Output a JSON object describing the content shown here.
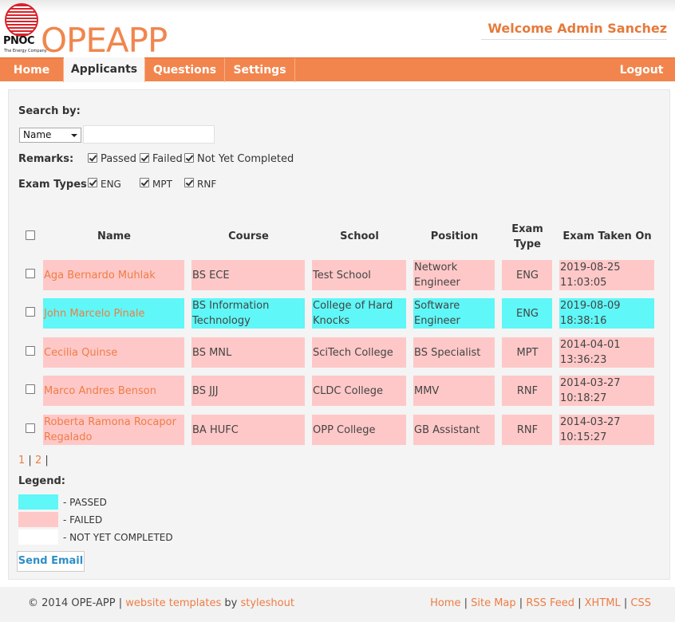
{
  "header": {
    "logo_text": "PNOC",
    "logo_tagline": "The Energy Company",
    "app_title": "OPEAPP",
    "welcome": "Welcome Admin Sanchez"
  },
  "nav": {
    "items": [
      "Home",
      "Applicants",
      "Questions",
      "Settings"
    ],
    "active": "Applicants",
    "logout": "Logout"
  },
  "filters": {
    "search_label": "Search by:",
    "search_field_selected": "Name",
    "search_value": "",
    "remarks_label": "Remarks:",
    "remarks": [
      {
        "label": "Passed",
        "checked": true
      },
      {
        "label": "Failed",
        "checked": true
      },
      {
        "label": "Not Yet Completed",
        "checked": true
      }
    ],
    "exam_types_label": "Exam Types:",
    "exam_types": [
      {
        "label": "ENG",
        "checked": true
      },
      {
        "label": "MPT",
        "checked": true
      },
      {
        "label": "RNF",
        "checked": true
      }
    ]
  },
  "table": {
    "columns": [
      "Name",
      "Course",
      "School",
      "Position",
      "Exam Type",
      "Exam Taken On"
    ],
    "rows": [
      {
        "name": "Aga Bernardo Muhlak",
        "course": "BS ECE",
        "school": "Test School",
        "position": "Network Engineer",
        "exam_type": "ENG",
        "taken_on": "2019-08-25 11:03:05",
        "status": "failed"
      },
      {
        "name": "John Marcelo Pinale",
        "course": "BS Information Technology",
        "school": "College of Hard Knocks",
        "position": "Software Engineer",
        "exam_type": "ENG",
        "taken_on": "2019-08-09 18:38:16",
        "status": "passed"
      },
      {
        "name": "Cecilia Quinse",
        "course": "BS MNL",
        "school": "SciTech College",
        "position": "BS Specialist",
        "exam_type": "MPT",
        "taken_on": "2014-04-01 13:36:23",
        "status": "failed"
      },
      {
        "name": "Marco Andres Benson",
        "course": "BS JJJ",
        "school": "CLDC College",
        "position": "MMV",
        "exam_type": "RNF",
        "taken_on": "2014-03-27 10:18:27",
        "status": "failed"
      },
      {
        "name": "Roberta Ramona Rocapor Regalado",
        "course": "BA HUFC",
        "school": "OPP College",
        "position": "GB Assistant",
        "exam_type": "RNF",
        "taken_on": "2014-03-27 10:15:27",
        "status": "failed"
      }
    ]
  },
  "pagination": {
    "pages": [
      "1",
      "2"
    ]
  },
  "legend": {
    "title": "Legend:",
    "items": [
      {
        "label": "- PASSED",
        "color": "#5ff7f7"
      },
      {
        "label": "- FAILED",
        "color": "#ffc8c8"
      },
      {
        "label": "- NOT YET COMPLETED",
        "color": "#ffffff"
      }
    ]
  },
  "send_email_label": "Send Email",
  "footer": {
    "copyright": "© 2014 OPE-APP |",
    "templates_link": "website templates",
    "by": "by",
    "author_link": "styleshout",
    "links": [
      "Home",
      "Site Map",
      "RSS Feed",
      "XHTML",
      "CSS"
    ]
  },
  "colors": {
    "accent": "#f2854d",
    "passed": "#5ff7f7",
    "failed": "#ffc8c8"
  }
}
